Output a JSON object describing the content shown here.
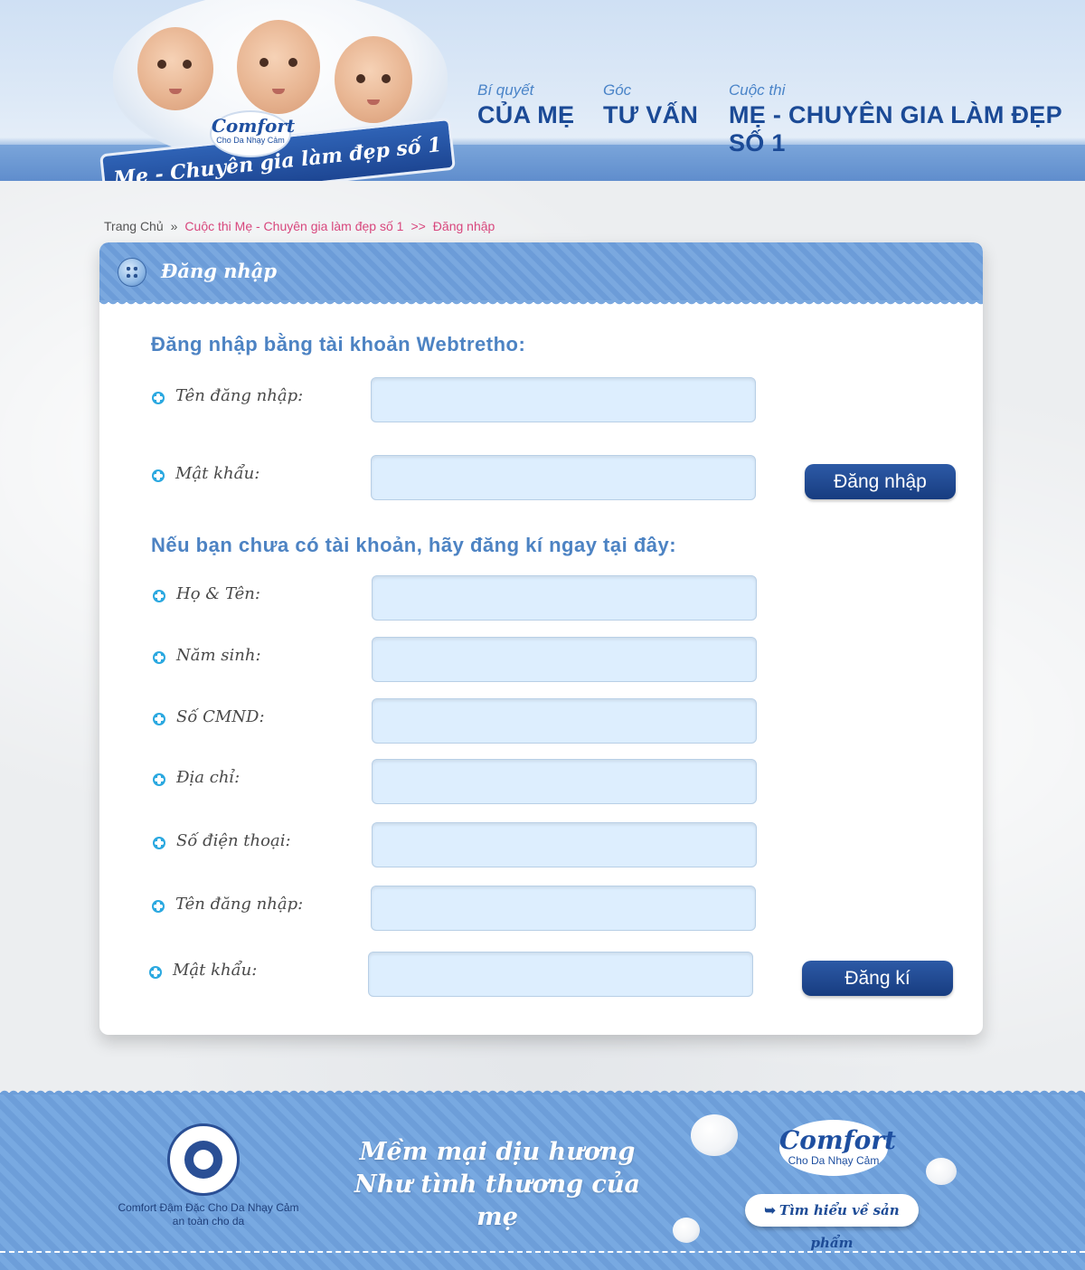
{
  "header": {
    "brand_logo": "Comfort",
    "brand_sub": "Cho Da Nhạy Cảm",
    "ribbon_text": "Mẹ - Chuyên gia làm đẹp số 1",
    "nav": [
      {
        "small": "Bí quyết",
        "big": "CỦA MẸ"
      },
      {
        "small": "Góc",
        "big": "TƯ VẤN"
      },
      {
        "small": "Cuộc thi",
        "big": "MẸ - CHUYÊN GIA LÀM ĐẸP SỐ 1"
      }
    ]
  },
  "breadcrumb": {
    "home": "Trang Chủ",
    "separator": "»",
    "contest": "Cuộc thi Mẹ - Chuyên gia làm đẹp số 1",
    "separator2": ">>",
    "current": "Đăng nhập"
  },
  "card": {
    "title": "Đăng nhập",
    "login_section": {
      "heading": "Đăng nhập bằng tài khoản Webtretho:",
      "fields": [
        {
          "label": "Tên đăng nhập:",
          "value": "",
          "placeholder": ""
        },
        {
          "label": "Mật khẩu:",
          "value": "",
          "placeholder": ""
        }
      ],
      "submit_label": "Đăng nhập"
    },
    "register_section": {
      "heading": "Nếu bạn chưa có tài khoản, hãy đăng kí ngay tại đây:",
      "fields": [
        {
          "label": "Họ & Tên:",
          "value": ""
        },
        {
          "label": "Năm sinh:",
          "value": ""
        },
        {
          "label": "Số CMND:",
          "value": ""
        },
        {
          "label": "Địa chỉ:",
          "value": ""
        },
        {
          "label": "Số điện thoại:",
          "value": ""
        },
        {
          "label": "Tên đăng nhập:",
          "value": ""
        },
        {
          "label": "Mật khẩu:",
          "value": ""
        }
      ],
      "submit_label": "Đăng kí"
    }
  },
  "footer": {
    "seal_caption_line1": "Comfort Đậm Đặc Cho Da Nhạy Cảm",
    "seal_caption_line2": "an toàn cho da",
    "slogan_line1": "Mềm mại dịu hương",
    "slogan_line2": "Như tình thương của mẹ",
    "logo": "Comfort",
    "logo_sub": "Cho Da Nhạy Cảm",
    "learn_more_label": "Tìm hiểu về sản phẩm"
  },
  "colors": {
    "accent_blue": "#4d83c3",
    "button_blue": "#173c80",
    "breadcrumb_pink": "#d8477d",
    "input_bg": "#ddeefe"
  }
}
